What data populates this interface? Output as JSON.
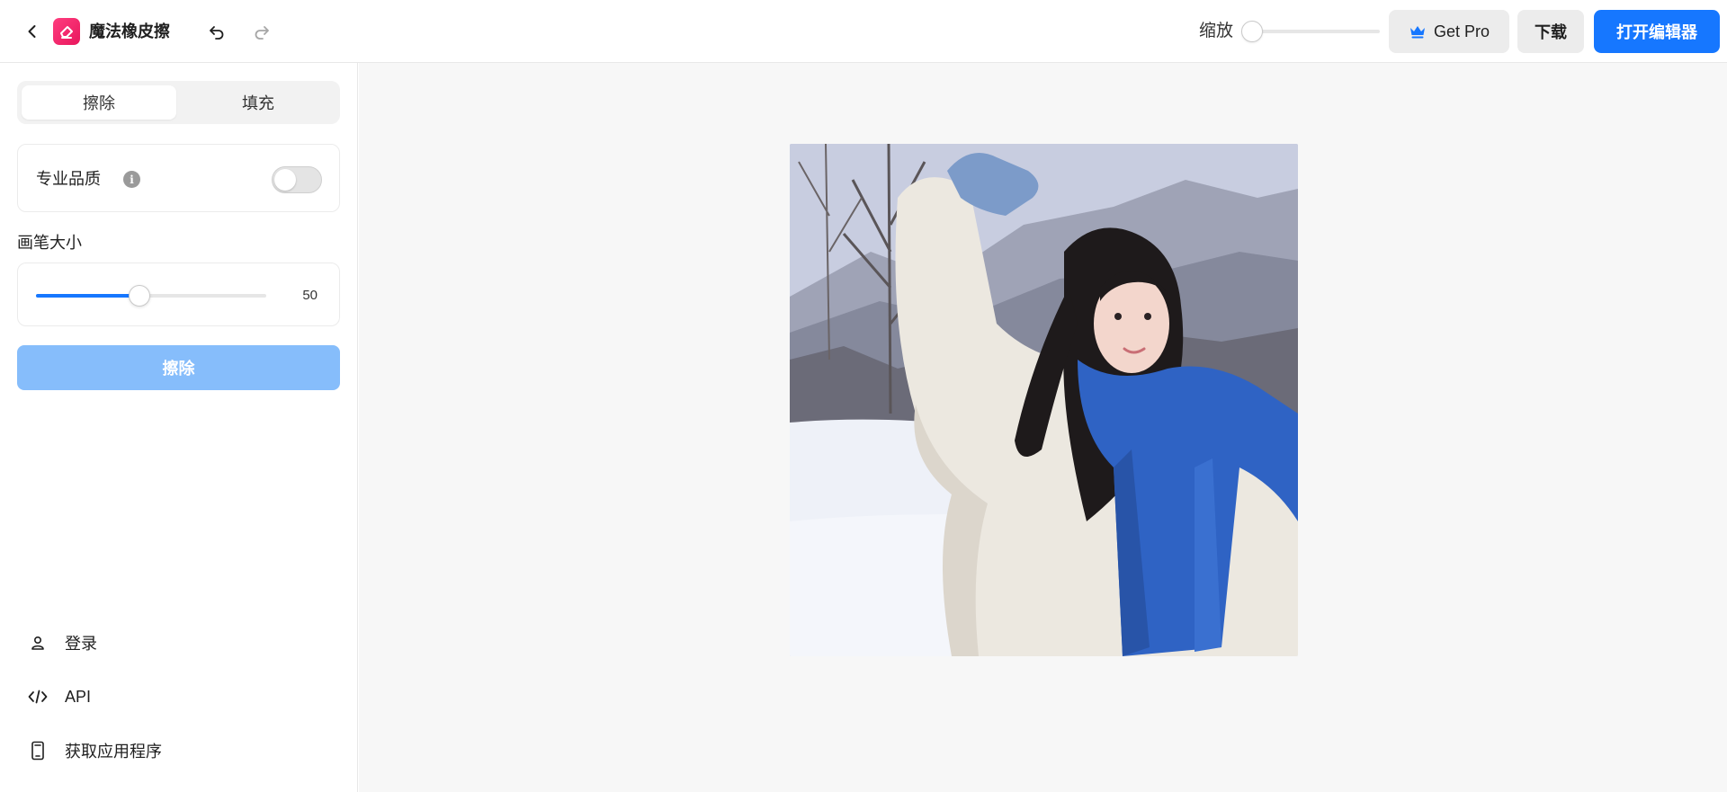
{
  "header": {
    "app_title": "魔法橡皮擦",
    "zoom_label": "缩放",
    "zoom_level": 0,
    "get_pro_label": "Get Pro",
    "download_label": "下载",
    "open_editor_label": "打开编辑器"
  },
  "sidebar": {
    "tabs": [
      {
        "label": "擦除",
        "active": true
      },
      {
        "label": "填充",
        "active": false
      }
    ],
    "pro_quality": {
      "label": "专业品质",
      "enabled": false
    },
    "brush": {
      "label": "画笔大小",
      "value": "50",
      "fraction": 0.45
    },
    "erase_button_label": "擦除",
    "nav": [
      {
        "label": "登录",
        "icon": "user-icon"
      },
      {
        "label": "API",
        "icon": "code-icon"
      },
      {
        "label": "获取应用程序",
        "icon": "phone-icon"
      }
    ]
  },
  "canvas": {
    "image_subject": "woman-in-snow-with-blue-scarf"
  },
  "colors": {
    "accent": "#1677ff",
    "accent_disabled": "#86bdfb",
    "logo": "#e8175d",
    "canvas_bg": "#f7f7f7"
  }
}
